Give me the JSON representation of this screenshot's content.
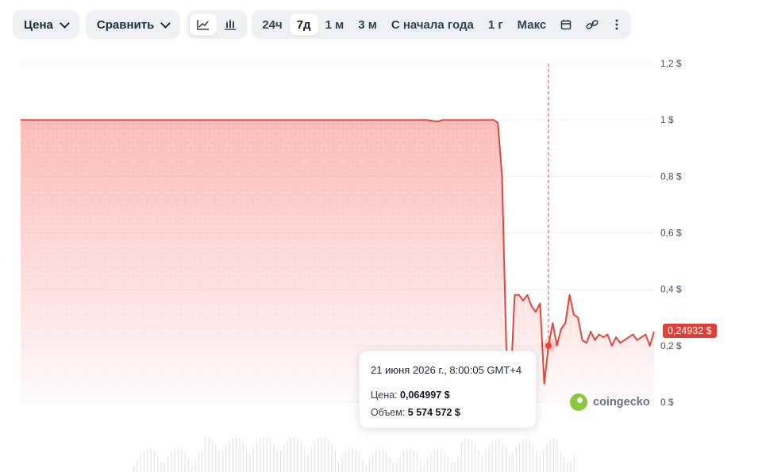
{
  "toolbar": {
    "price_label": "Цена",
    "compare_label": "Сравнить",
    "ranges": [
      "24ч",
      "7д",
      "1 м",
      "3 м",
      "С начала года",
      "1 г",
      "Макс"
    ],
    "active_range": "7д"
  },
  "tooltip": {
    "date": "21 июня 2026 г., 8:00:05 GMT+4",
    "price_label": "Цена:",
    "price_value": "0,064997 $",
    "volume_label": "Объем:",
    "volume_value": "5 574 572 $"
  },
  "watermark": "coingecko",
  "current_price": "0,24932 $",
  "colors": {
    "line": "#e2463c",
    "area": "#f8a5a0",
    "badge": "#e23d36"
  },
  "chart_data": {
    "type": "area",
    "title": "",
    "xlabel": "",
    "ylabel": "",
    "ylim": [
      0,
      1.2
    ],
    "yticks": [
      0,
      0.2,
      0.4,
      0.6,
      0.8,
      1,
      1.2
    ],
    "ytick_labels": [
      "0 $",
      "0,2 $",
      "0,4 $",
      "0,6 $",
      "0,8 $",
      "1 $",
      "1,2 $"
    ],
    "grid": true,
    "series": [
      {
        "values": [
          1,
          1,
          1,
          1,
          1,
          1,
          1,
          1,
          1,
          1,
          1,
          1,
          1,
          1,
          1,
          1,
          1,
          1,
          1,
          1,
          1,
          1,
          1,
          1,
          1,
          1,
          1,
          1,
          1,
          1,
          1,
          1,
          1,
          1,
          1,
          1,
          1,
          1,
          1,
          1,
          1,
          1,
          1,
          1,
          1,
          1,
          1,
          1,
          1,
          1,
          1,
          1,
          1,
          1,
          1,
          1,
          1,
          1,
          1,
          1,
          1,
          1,
          1,
          1,
          1,
          1,
          1,
          1,
          1,
          1,
          1,
          1,
          1,
          1,
          1,
          1,
          1,
          1,
          1,
          1,
          1,
          1,
          1,
          1,
          1,
          1,
          1,
          1,
          1,
          1,
          1,
          1,
          1,
          1,
          1,
          1,
          1,
          0.998,
          0.995,
          0.995,
          1,
          1,
          1,
          1,
          1,
          1,
          1,
          1,
          1,
          1,
          1,
          1,
          1,
          0.99,
          0.8,
          0.2,
          0.05,
          0.38,
          0.38,
          0.36,
          0.38,
          0.34,
          0.32,
          0.35,
          0.065,
          0.2,
          0.28,
          0.2,
          0.26,
          0.28,
          0.38,
          0.31,
          0.3,
          0.22,
          0.21,
          0.25,
          0.22,
          0.24,
          0.23,
          0.24,
          0.2,
          0.23,
          0.21,
          0.22,
          0.23,
          0.24,
          0.22,
          0.23,
          0.24,
          0.2,
          0.25
        ]
      }
    ],
    "hover_index": 125,
    "volume_bars": true
  }
}
